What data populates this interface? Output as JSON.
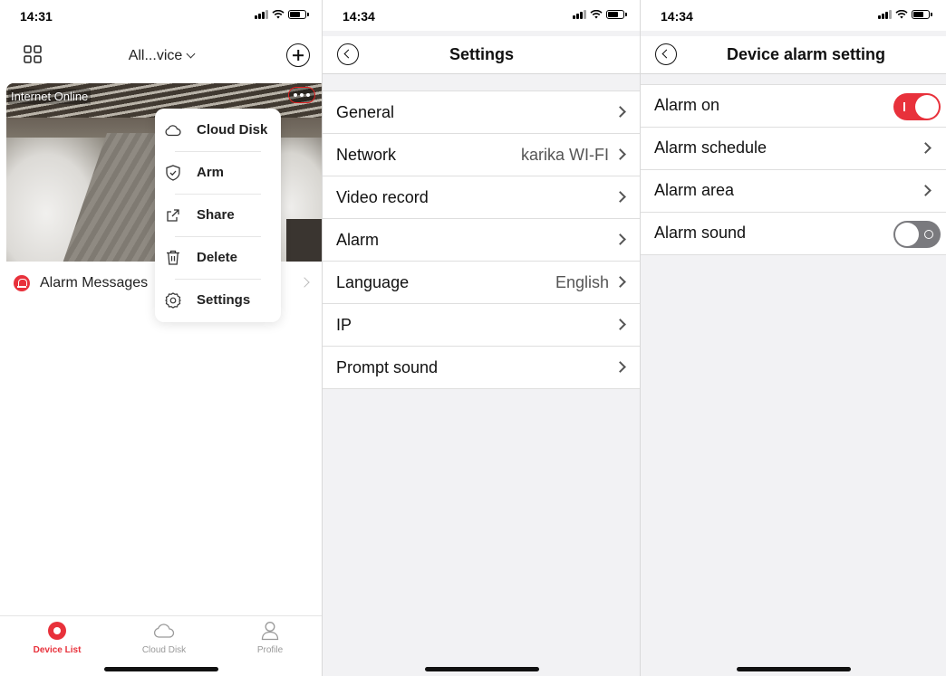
{
  "screens": [
    {
      "status": {
        "time": "14:31"
      },
      "header": {
        "title": "All...vice"
      },
      "camera": {
        "status_label": "Internet Online"
      },
      "alarm_messages": {
        "label": "Alarm Messages"
      },
      "menu": {
        "items": [
          {
            "label": "Cloud Disk",
            "icon": "cloud-icon"
          },
          {
            "label": "Arm",
            "icon": "shield-check-icon"
          },
          {
            "label": "Share",
            "icon": "share-icon"
          },
          {
            "label": "Delete",
            "icon": "trash-icon"
          },
          {
            "label": "Settings",
            "icon": "gear-icon"
          }
        ]
      },
      "tabbar": {
        "items": [
          {
            "label": "Device List",
            "icon": "record-icon",
            "active": true
          },
          {
            "label": "Cloud Disk",
            "icon": "cloud-icon",
            "active": false
          },
          {
            "label": "Profile",
            "icon": "person-icon",
            "active": false
          }
        ]
      }
    },
    {
      "status": {
        "time": "14:34"
      },
      "nav": {
        "title": "Settings"
      },
      "rows": [
        {
          "label": "General",
          "value": ""
        },
        {
          "label": "Network",
          "value": "karika WI-FI"
        },
        {
          "label": "Video record",
          "value": ""
        },
        {
          "label": "Alarm",
          "value": ""
        },
        {
          "label": "Language",
          "value": "English"
        },
        {
          "label": "IP",
          "value": ""
        },
        {
          "label": "Prompt sound",
          "value": ""
        }
      ]
    },
    {
      "status": {
        "time": "14:34"
      },
      "nav": {
        "title": "Device alarm setting"
      },
      "rows": [
        {
          "label": "Alarm on",
          "control": "toggle",
          "on": true
        },
        {
          "label": "Alarm schedule",
          "control": "chevron"
        },
        {
          "label": "Alarm area",
          "control": "chevron"
        },
        {
          "label": "Alarm sound",
          "control": "toggle",
          "on": false
        }
      ]
    }
  ],
  "colors": {
    "accent": "#e8313b",
    "toggle_off": "#7a7a7e",
    "background": "#f2f2f4"
  }
}
